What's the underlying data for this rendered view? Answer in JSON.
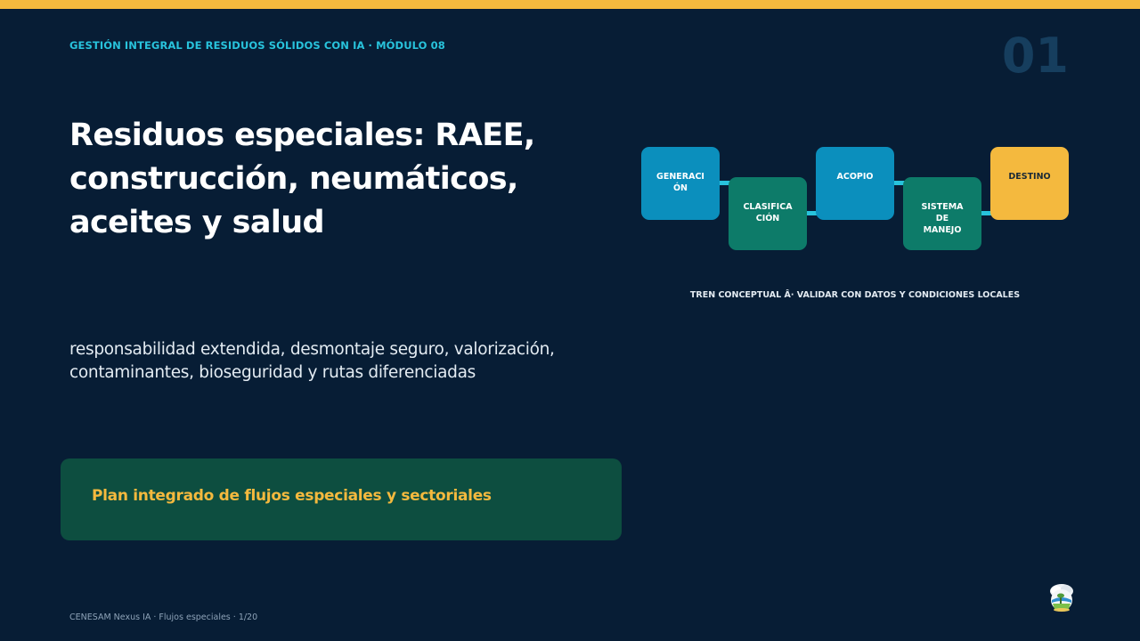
{
  "header": {
    "module_label": "GESTIÓN INTEGRAL DE RESIDUOS SÓLIDOS CON IA · MÓDULO 08",
    "slide_number": "01"
  },
  "main": {
    "title": "Residuos especiales: RAEE, construcción, neumáticos, aceites y salud",
    "subtitle": "responsabilidad extendida, desmontaje seguro, valorización, contaminantes, bioseguridad y rutas diferenciadas",
    "plan_text": "Plan integrado de flujos especiales y sectoriales"
  },
  "flow": {
    "nodes": [
      {
        "label": "GENERACIÓN",
        "color": "#0b8fbd"
      },
      {
        "label": "CLASIFICACIÓN",
        "color": "#0d7b69"
      },
      {
        "label": "ACOPIO",
        "color": "#0b8fbd"
      },
      {
        "label": "SISTEMA DE MANEJO",
        "color": "#0d7b69"
      },
      {
        "label": "DESTINO",
        "color": "#f4b93e"
      }
    ],
    "caption": "TREN CONCEPTUAL Â· VALIDAR CON DATOS Y CONDICIONES LOCALES"
  },
  "footer": {
    "text": "CENESAM Nexus IA · Flujos especiales · 1/20"
  },
  "colors": {
    "background": "#071d35",
    "accent_yellow": "#f4b93e",
    "accent_cyan": "#28c3dc",
    "node_blue": "#0b8fbd",
    "node_green": "#0d7b69",
    "panel_green": "#0d4e40"
  }
}
